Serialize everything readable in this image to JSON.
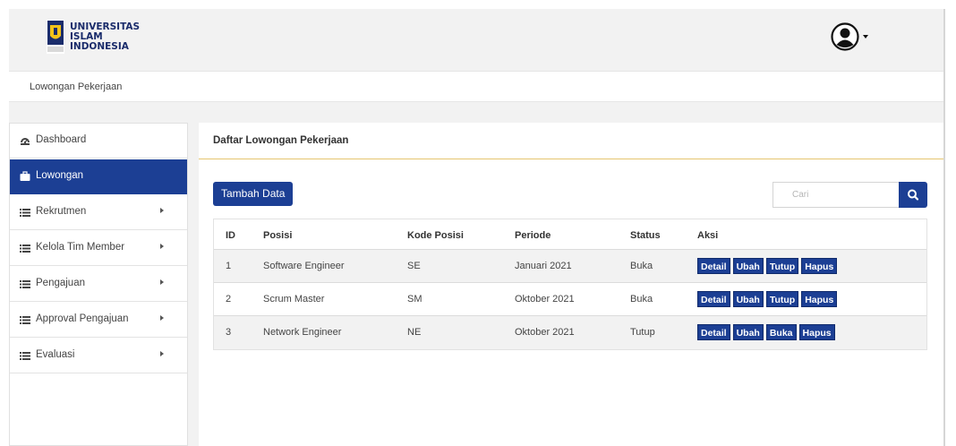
{
  "header": {
    "logo_lines": [
      "UNIVERSITAS",
      "ISLAM",
      "INDONESIA"
    ],
    "user_icon": "user-circle-icon"
  },
  "breadcrumb": {
    "label": "Lowongan Pekerjaan"
  },
  "sidebar": {
    "items": [
      {
        "label": "Dashboard",
        "icon": "dashboard-icon",
        "active": false,
        "has_submenu": false
      },
      {
        "label": "Lowongan",
        "icon": "briefcase-icon",
        "active": true,
        "has_submenu": false
      },
      {
        "label": "Rekrutmen",
        "icon": "list-icon",
        "active": false,
        "has_submenu": true
      },
      {
        "label": "Kelola Tim Member",
        "icon": "list-icon",
        "active": false,
        "has_submenu": true
      },
      {
        "label": "Pengajuan",
        "icon": "list-icon",
        "active": false,
        "has_submenu": true
      },
      {
        "label": "Approval Pengajuan",
        "icon": "list-icon",
        "active": false,
        "has_submenu": true
      },
      {
        "label": "Evaluasi",
        "icon": "list-icon",
        "active": false,
        "has_submenu": true
      }
    ]
  },
  "panel": {
    "title": "Daftar Lowongan Pekerjaan",
    "add_button": "Tambah Data",
    "search": {
      "placeholder": "Cari",
      "icon": "search-icon"
    },
    "table": {
      "columns": [
        "ID",
        "Posisi",
        "Kode Posisi",
        "Periode",
        "Status",
        "Aksi"
      ],
      "rows": [
        {
          "id": "1",
          "posisi": "Software Engineer",
          "kode": "SE",
          "periode": "Januari 2021",
          "status": "Buka",
          "actions": [
            "Detail",
            "Ubah",
            "Tutup",
            "Hapus"
          ]
        },
        {
          "id": "2",
          "posisi": "Scrum Master",
          "kode": "SM",
          "periode": "Oktober 2021",
          "status": "Buka",
          "actions": [
            "Detail",
            "Ubah",
            "Tutup",
            "Hapus"
          ]
        },
        {
          "id": "3",
          "posisi": "Network Engineer",
          "kode": "NE",
          "periode": "Oktober 2021",
          "status": "Tutup",
          "actions": [
            "Detail",
            "Ubah",
            "Buka",
            "Hapus"
          ]
        }
      ]
    }
  },
  "colors": {
    "primary": "#1c3f94",
    "accent_line": "#e5c56f",
    "stripe": "#f2f2f2"
  }
}
